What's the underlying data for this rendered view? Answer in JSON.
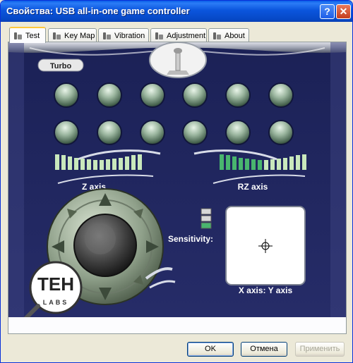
{
  "window": {
    "title": "Свойства: USB all-in-one game controller"
  },
  "tabs": [
    {
      "label": "Test",
      "active": true
    },
    {
      "label": "Key Map",
      "active": false
    },
    {
      "label": "Vibration",
      "active": false
    },
    {
      "label": "Adjustment",
      "active": false
    },
    {
      "label": "About",
      "active": false
    }
  ],
  "test_panel": {
    "turbo_label": "Turbo",
    "z_axis_label": "Z axis",
    "rz_axis_label": "RZ axis",
    "sensitivity_label": "Sensitivity:",
    "xy_axis_label": "X axis: Y axis",
    "logo_text_main": "TEH",
    "logo_text_sub": "LABS",
    "z_axis_level": 1.0,
    "rz_axis_level": 0.5,
    "sensitivity_level": 1,
    "sensitivity_max": 3,
    "button_count": 12
  },
  "dialog_buttons": {
    "ok": "OK",
    "cancel": "Отмена",
    "apply": "Применить"
  },
  "colors": {
    "background": "#1c2257",
    "accent_green": "#49b56e",
    "bar_light": "#c9e8bc"
  }
}
